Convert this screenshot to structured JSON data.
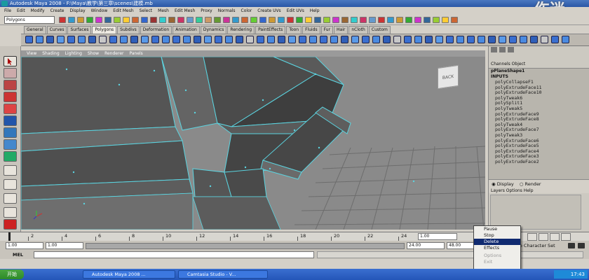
{
  "window": {
    "title": "Autodesk Maya 2008 - F:\\Maya\\教学\\第三章\\scenes\\建模.mb"
  },
  "menubar": [
    "File",
    "Edit",
    "Modify",
    "Create",
    "Display",
    "Window",
    "Edit Mesh",
    "Select",
    "Mesh",
    "Edit Mesh",
    "Proxy",
    "Normals",
    "Color",
    "Create UVs",
    "Edit UVs",
    "Help"
  ],
  "status_line": {
    "mode": "Polygons"
  },
  "shelf_tabs": [
    {
      "label": "General"
    },
    {
      "label": "Curves"
    },
    {
      "label": "Surfaces"
    },
    {
      "label": "Polygons",
      "active": true
    },
    {
      "label": "Subdivs"
    },
    {
      "label": "Deformation"
    },
    {
      "label": "Animation"
    },
    {
      "label": "Dynamics"
    },
    {
      "label": "Rendering"
    },
    {
      "label": "PaintEffects"
    },
    {
      "label": "Toon"
    },
    {
      "label": "Fluids"
    },
    {
      "label": "Fur"
    },
    {
      "label": "Hair"
    },
    {
      "label": "nCloth"
    },
    {
      "label": "Custom"
    }
  ],
  "panel_menu": [
    "View",
    "Shading",
    "Lighting",
    "Show",
    "Renderer",
    "Panels"
  ],
  "viewcube": {
    "label": "BACK"
  },
  "channel_box": {
    "tabs_label": "Channels  Object",
    "node": "pPlaneShape1",
    "inputs_label": "INPUTS",
    "inputs": [
      "polyCollapseF1",
      "polyExtrudeFace11",
      "polyExtrudeFace10",
      "polyTweak6",
      "polySplit1",
      "polyTweak5",
      "polyExtrudeFace9",
      "polyExtrudeFace8",
      "polyTweak4",
      "polyExtrudeFace7",
      "polyTweak3",
      "polyExtrudeFace6",
      "polyExtrudeFace5",
      "polyExtrudeFace4",
      "polyExtrudeFace3",
      "polyExtrudeFace2"
    ],
    "layer_display": "Display",
    "layer_render": "Render",
    "layer_menu": "Layers  Options  Help"
  },
  "timeline": {
    "ticks": [
      "2",
      "4",
      "6",
      "8",
      "10",
      "12",
      "14",
      "16",
      "18",
      "20",
      "22",
      "24"
    ],
    "current_frame": "1.00"
  },
  "range": {
    "start": "1.00",
    "inner_start": "1.00",
    "inner_end": "24.00",
    "end": "48.00",
    "character_set": "No Character Set"
  },
  "command_line": {
    "label": "MEL"
  },
  "context_menu": {
    "items": [
      {
        "label": "Pause"
      },
      {
        "label": "Stop"
      },
      {
        "label": "Delete",
        "selected": true
      },
      {
        "label": "Effects"
      },
      {
        "label": "Options",
        "disabled": true
      },
      {
        "label": "Exit",
        "disabled": true
      }
    ]
  },
  "taskbar": {
    "start_label": "开始",
    "tasks": [
      "Autodesk Maya 2008 ...",
      "Camtasia Studio - V..."
    ],
    "clock": "17:43"
  },
  "watermark": "伤迷"
}
